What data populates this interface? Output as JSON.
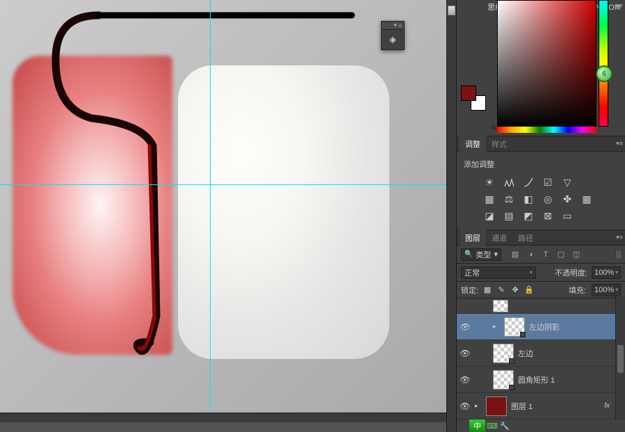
{
  "watermark": {
    "site": "思缘设计论坛",
    "url": "WWW.MISSYUAN.COM"
  },
  "floating": {
    "close": "×",
    "menu": "▾",
    "icon": "⬚"
  },
  "guides": {
    "v1": 302,
    "h1": 265
  },
  "hue_slider_value": "6",
  "adjust": {
    "tab1": "调整",
    "tab2": "样式",
    "title": "添加调整"
  },
  "layers": {
    "tab1": "图层",
    "tab2": "通道",
    "tab3": "路径",
    "filter_label": "类型",
    "blend_mode": "正常",
    "opacity_label": "不透明度:",
    "opacity_value": "100%",
    "lock_label": "锁定:",
    "fill_label": "填充:",
    "fill_value": "100%",
    "items": [
      {
        "name": "左边阴影"
      },
      {
        "name": "左边"
      },
      {
        "name": "圆角矩形 1"
      },
      {
        "name": "图层 1"
      }
    ],
    "fx": "fx"
  },
  "status": {
    "ime": "中"
  }
}
